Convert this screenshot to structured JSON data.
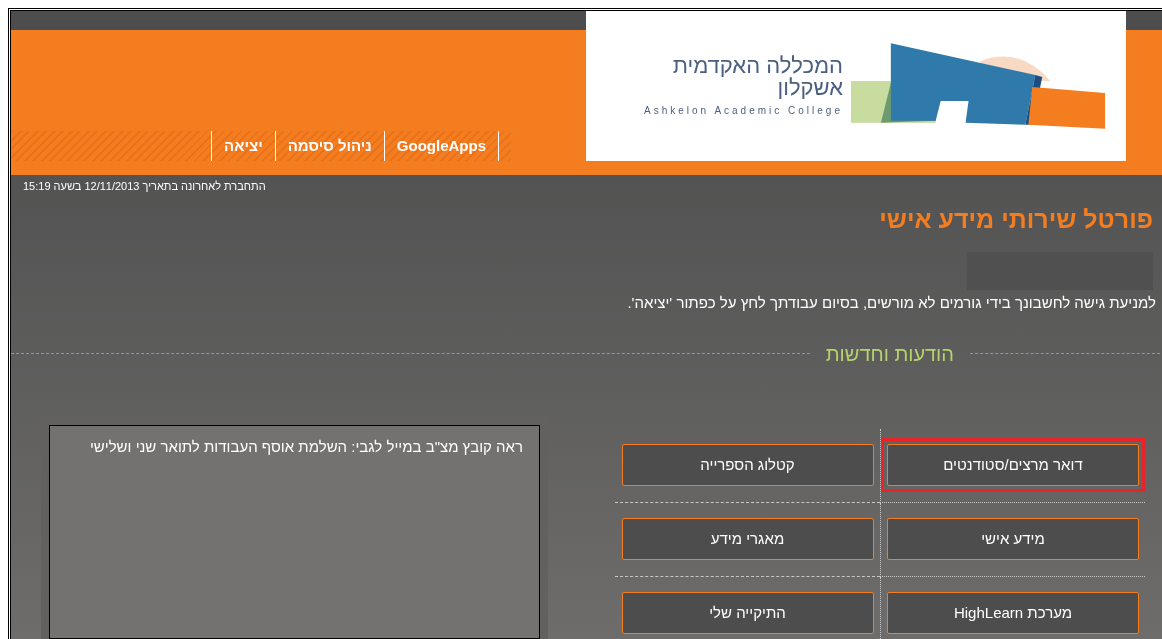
{
  "logo": {
    "hebrew": "המכללה האקדמית אשקלון",
    "english": "Ashkelon Academic College"
  },
  "nav": [
    "GoogleApps",
    "ניהול סיסמה",
    "יציאה"
  ],
  "last_login": "התחברת לאחרונה בתאריך 12/11/2013 בשעה 15:19",
  "title": "פורטל שירותי מידע אישי",
  "notice": "למניעת גישה לחשבונך בידי גורמים לא מורשים, בסיום עבודתך לחץ על כפתור 'יציאה'.",
  "news": {
    "heading": "הודעות וחדשות",
    "text": "ראה קובץ מצ\"ב במייל לגבי: השלמת אוסף העבודות לתואר שני ושלישי"
  },
  "services": [
    {
      "label": "דואר מרצים/סטודנטים",
      "highlighted": true
    },
    {
      "label": "קטלוג הספרייה",
      "highlighted": false
    },
    {
      "label": "מידע אישי",
      "highlighted": false
    },
    {
      "label": "מאגרי מידע",
      "highlighted": false
    },
    {
      "label": "מערכת HighLearn",
      "highlighted": false
    },
    {
      "label": "התיקייה שלי",
      "highlighted": false
    }
  ]
}
